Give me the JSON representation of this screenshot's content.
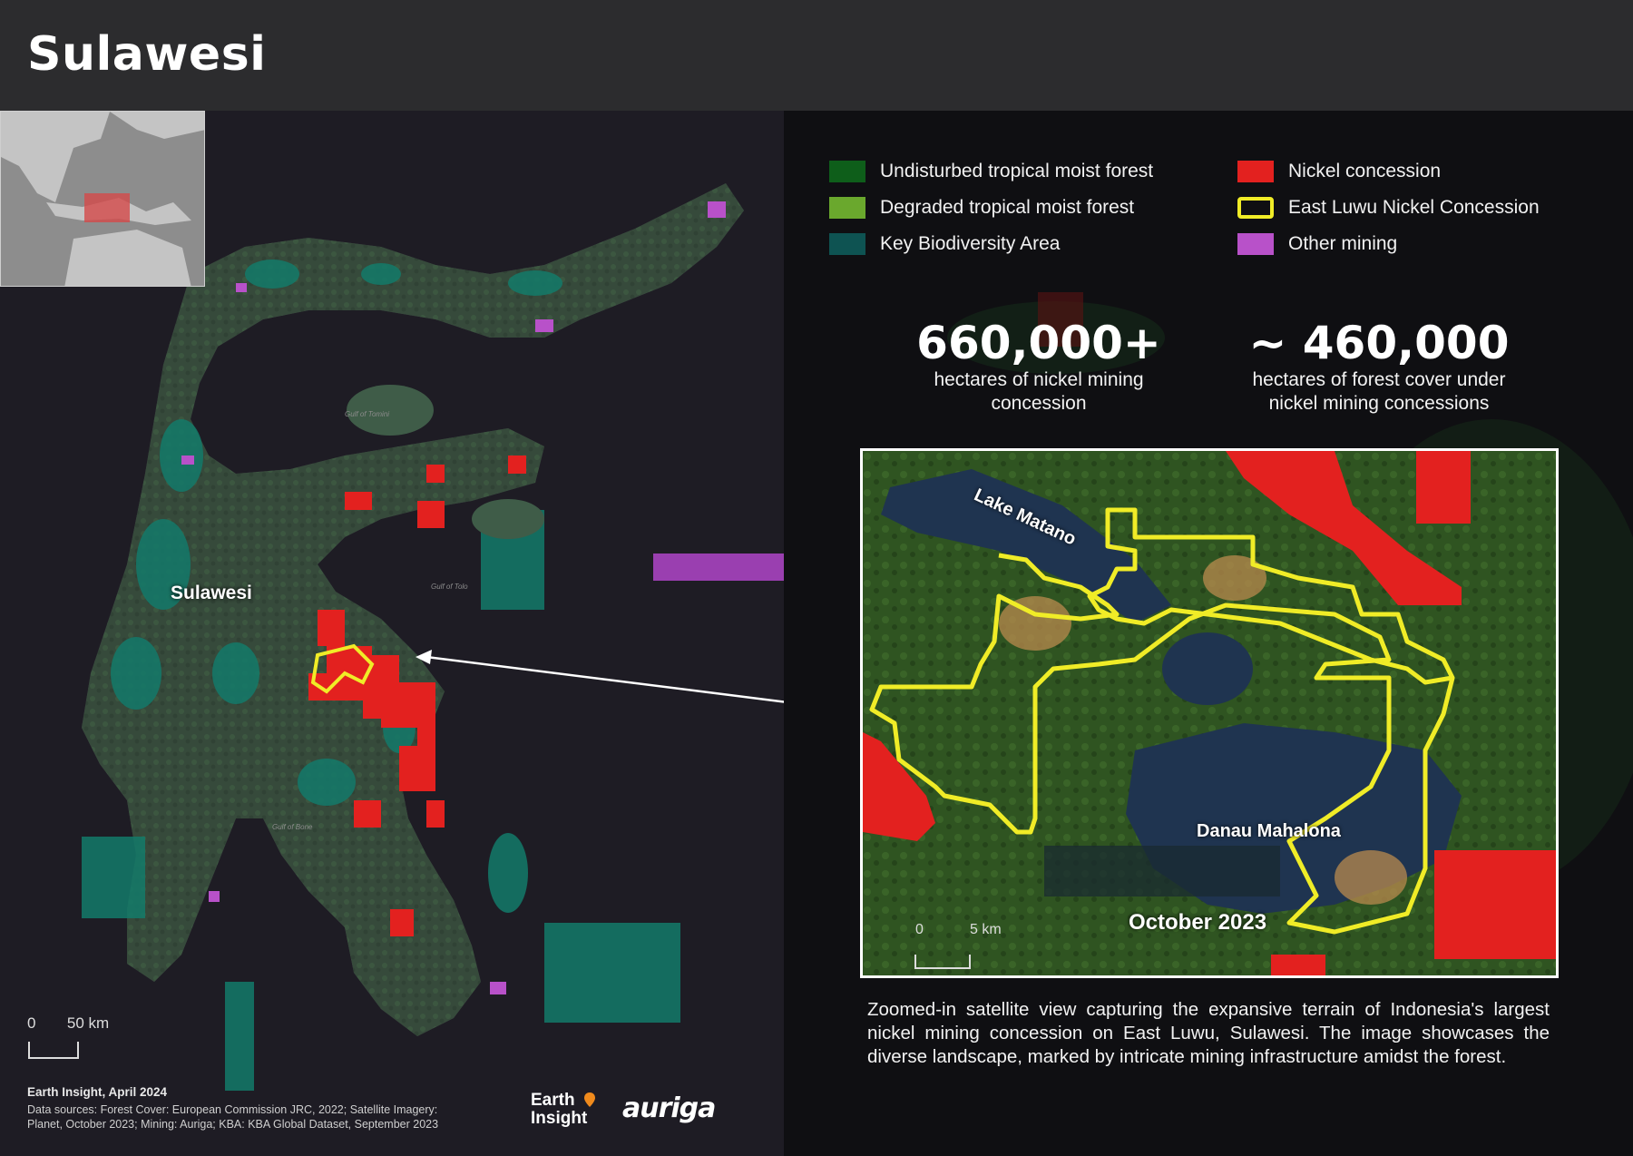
{
  "header": {
    "title": "Sulawesi"
  },
  "legend": {
    "items": [
      {
        "label": "Undisturbed tropical moist forest",
        "color": "#0e5e1a",
        "style": "fill"
      },
      {
        "label": "Degraded tropical moist forest",
        "color": "#6aa82d",
        "style": "fill"
      },
      {
        "label": "Key Biodiversity Area",
        "color": "#0e5352",
        "style": "fill"
      },
      {
        "label": "Nickel concession",
        "color": "#e3211f",
        "style": "fill"
      },
      {
        "label": "East Luwu Nickel Concession",
        "color": "#f0ec27",
        "style": "outline"
      },
      {
        "label": "Other mining",
        "color": "#b851c9",
        "style": "fill"
      }
    ]
  },
  "stats": [
    {
      "value": "660,000+",
      "label_line1": "hectares of nickel mining",
      "label_line2": "concession"
    },
    {
      "value": "~ 460,000",
      "label_line1": "hectares of forest cover under",
      "label_line2": "nickel mining concessions"
    }
  ],
  "map": {
    "region_label": "Sulawesi",
    "water_labels": [
      "Gulf of Tomini",
      "Gulf of Tolo",
      "Gulf of Bone"
    ],
    "scale": {
      "start": "0",
      "end": "50 km"
    }
  },
  "zoom_view": {
    "labels": {
      "lake1": "Lake Matano",
      "lake2": "Danau Mahalona"
    },
    "date": "October 2023",
    "scale": {
      "start": "0",
      "end": "5 km"
    }
  },
  "caption": "Zoomed-in satellite view capturing the expansive terrain of Indonesia's largest nickel mining concession on East Luwu, Sulawesi. The image showcases the diverse landscape, marked by intricate mining infrastructure amidst the forest.",
  "footer": {
    "credit": "Earth Insight,  April 2024",
    "sources_line1": "Data sources: Forest Cover: European Commission JRC,  2022; Satellite Imagery:",
    "sources_line2": "Planet, October 2023; Mining: Auriga; KBA: KBA Global Dataset, September 2023",
    "logo1_line1": "Earth",
    "logo1_line2": "Insight",
    "logo2": "auriga"
  }
}
